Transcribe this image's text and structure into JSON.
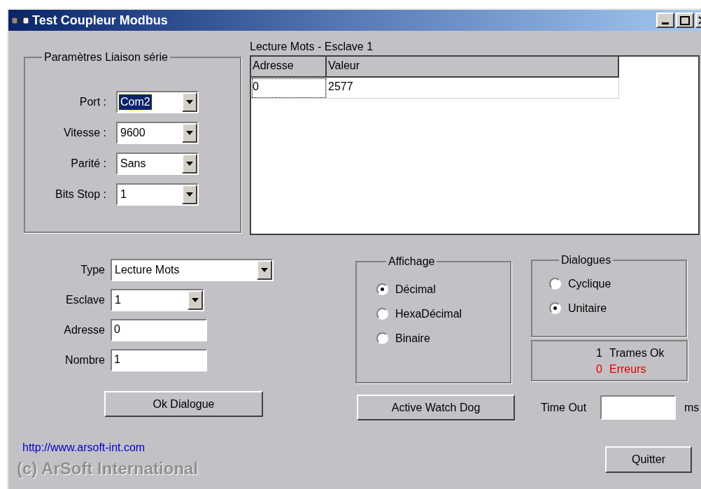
{
  "window": {
    "title": "Test Coupleur Modbus"
  },
  "serial_group": {
    "title": "Paramètres Liaison série",
    "fields": [
      {
        "label": "Port :",
        "value": "Com2",
        "focused": true
      },
      {
        "label": "Vitesse :",
        "value": "9600",
        "focused": false
      },
      {
        "label": "Parité :",
        "value": "Sans",
        "focused": false
      },
      {
        "label": "Bits Stop :",
        "value": "1",
        "focused": false
      }
    ]
  },
  "table": {
    "title": "Lecture Mots - Esclave 1",
    "columns": [
      "Adresse",
      "Valeur"
    ],
    "rows": [
      [
        "0",
        "2577"
      ]
    ]
  },
  "request": {
    "fields": [
      {
        "label": "Type",
        "kind": "dropdown",
        "value": "Lecture Mots"
      },
      {
        "label": "Esclave",
        "kind": "dropdown",
        "value": "1"
      },
      {
        "label": "Adresse",
        "kind": "text",
        "value": "0"
      },
      {
        "label": "Nombre",
        "kind": "text",
        "value": "1"
      }
    ],
    "button": "Ok Dialogue"
  },
  "display_group": {
    "title": "Affichage",
    "options": [
      {
        "label": "Décimal",
        "selected": true
      },
      {
        "label": "HexaDécimal",
        "selected": false
      },
      {
        "label": "Binaire",
        "selected": false
      }
    ]
  },
  "watchdog_button": "Active Watch Dog",
  "dialog_group": {
    "title": "Dialogues",
    "options": [
      {
        "label": "Cyclique",
        "selected": false
      },
      {
        "label": "Unitaire",
        "selected": true
      }
    ]
  },
  "counters": [
    {
      "count": "1",
      "label": "Trames Ok",
      "color": "#000000"
    },
    {
      "count": "0",
      "label": "Erreurs",
      "color": "#e00000"
    }
  ],
  "timeout": {
    "label": "Time Out",
    "unit": "ms"
  },
  "link": "http://www.arsoft-int.com",
  "copyright": "(c) ArSoft International",
  "quit_button": "Quitter"
}
